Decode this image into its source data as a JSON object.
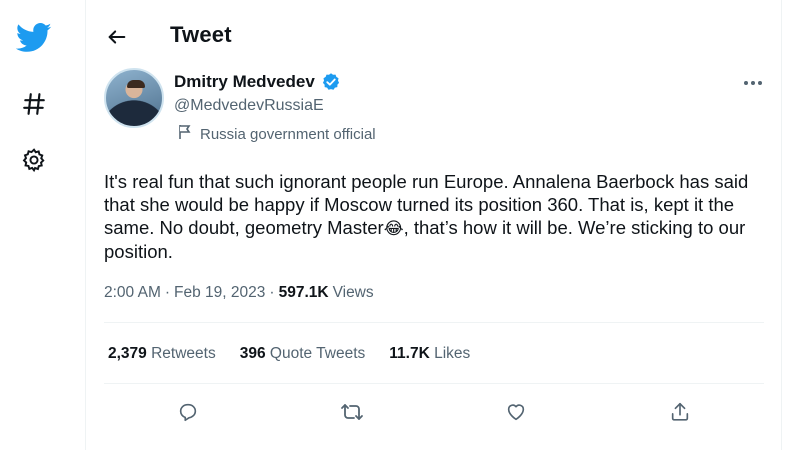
{
  "colors": {
    "brand": "#1d9bf0",
    "text": "#0f1419",
    "muted": "#536471",
    "border": "#eff3f4"
  },
  "nav": {
    "logo_icon": "twitter-bird-icon",
    "explore_icon": "hashtag-icon",
    "settings_icon": "gear-icon"
  },
  "header": {
    "back_icon": "arrow-left-icon",
    "title": "Tweet"
  },
  "author": {
    "name": "Dmitry Medvedev",
    "handle": "@MedvedevRussiaE",
    "verified_icon": "verified-badge-icon",
    "label_icon": "flag-icon",
    "label": "Russia government official"
  },
  "tweet": {
    "text_before_emoji": "It's real fun that such ignorant people run Europe. Annalena Baerbock has said that she would be happy if Moscow turned its position 360. That is, kept it the same. No doubt, geometry Master",
    "emoji": "😂",
    "text_after_emoji": ", that’s how it will be. We’re sticking to our position."
  },
  "meta": {
    "time": "2:00 AM",
    "sep1": "·",
    "date": "Feb 19, 2023",
    "sep2": "·",
    "views_count": "597.1K",
    "views_label": "Views"
  },
  "stats": {
    "retweets_count": "2,379",
    "retweets_label": "Retweets",
    "quotes_count": "396",
    "quotes_label": "Quote Tweets",
    "likes_count": "11.7K",
    "likes_label": "Likes"
  },
  "actions": {
    "reply_icon": "reply-bubble-icon",
    "retweet_icon": "retweet-icon",
    "like_icon": "heart-icon",
    "share_icon": "share-icon",
    "more_icon": "more-dots-icon"
  }
}
